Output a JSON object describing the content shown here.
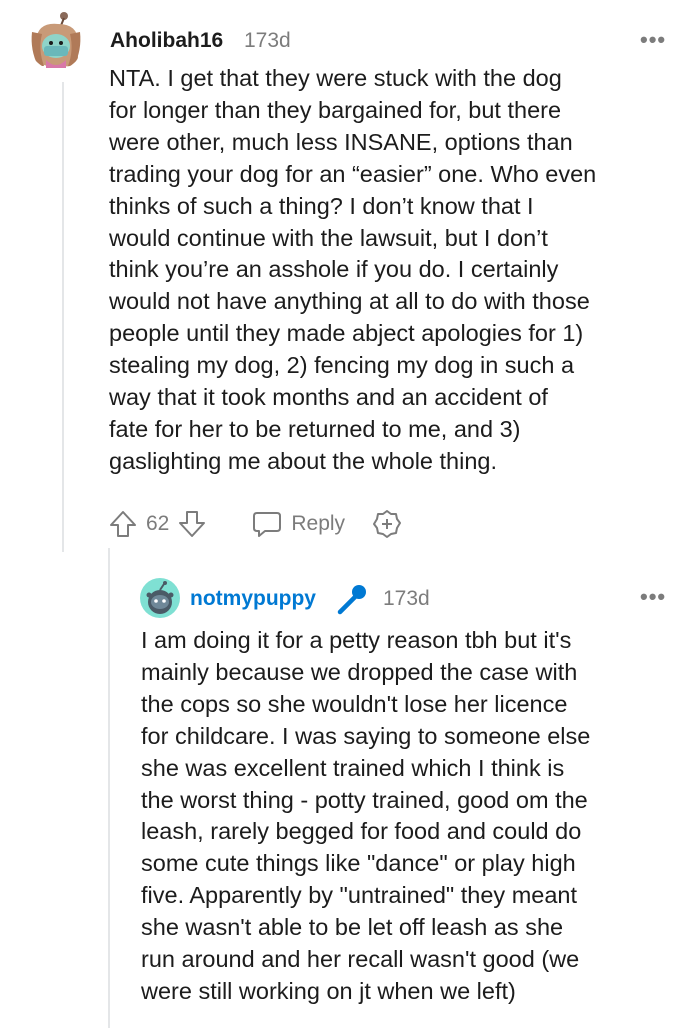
{
  "comment": {
    "username": "Aholibah16",
    "time": "173d",
    "body": "NTA. I get that they were stuck with the dog\nfor longer than they bargained for, but there\nwere other, much less INSANE, options than\ntrading your dog for an “easier” one. Who even\nthinks of such a thing? I don’t know that I\nwould continue with the lawsuit, but I don’t\nthink you’re an asshole if you do. I certainly\nwould not have anything at all to do with those\npeople until they made abject apologies for 1)\nstealing my dog, 2) fencing my dog in such a\nway that it took months and an accident of\nfate for her to be returned to me, and 3)\ngaslighting me about the whole thing.",
    "votes": "62",
    "reply_label": "Reply",
    "avatar_icon": "snoo-avatar-icon"
  },
  "reply": {
    "username": "notmypuppy",
    "username_color": "#0079d3",
    "time": "173d",
    "badge_icon": "microphone-icon",
    "body": "I am doing it for a petty reason tbh but it's\nmainly because we dropped the case with\nthe cops so she wouldn't lose her licence\nfor childcare. I was saying to someone else\nshe was excellent trained which I think is\nthe worst thing - potty trained, good om the\nleash, rarely begged for food and could do\nsome cute things like \"dance\" or play high\nfive. Apparently by \"untrained\" they meant\nshe wasn't able to be let off leash as she\nrun around and her recall wasn't good (we\nwere still working on jt when we left)"
  },
  "more_label": "•••"
}
